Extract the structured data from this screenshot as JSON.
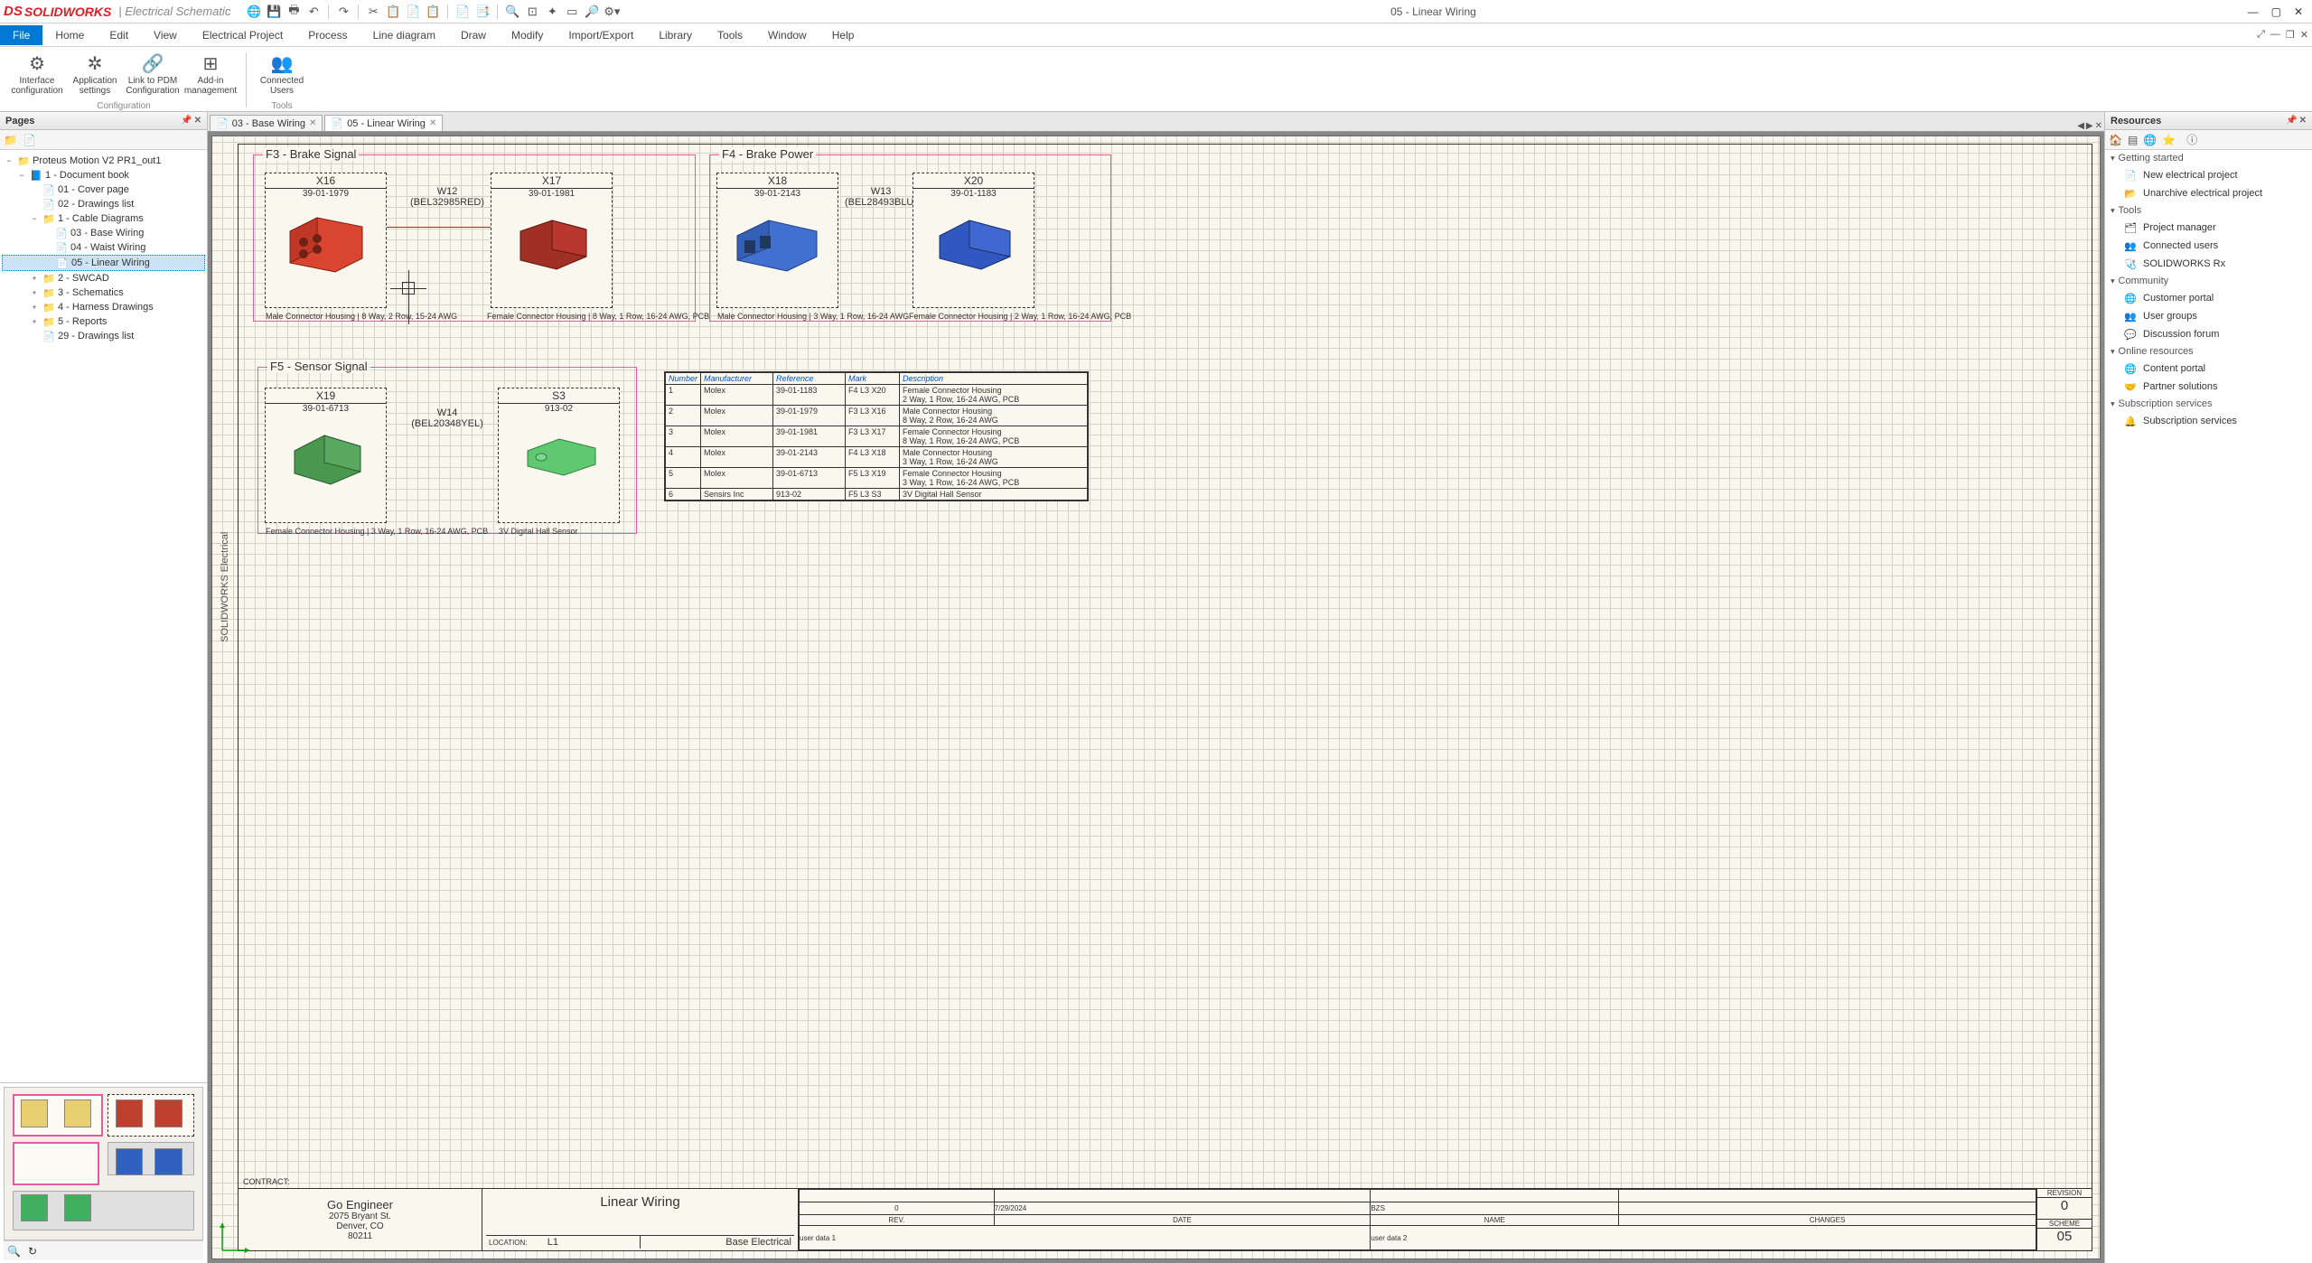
{
  "app": {
    "logo_ds": "DS",
    "logo": "SOLIDWORKS",
    "subtitle": "| Electrical Schematic",
    "window_title": "05 - Linear Wiring"
  },
  "menu": {
    "file": "File",
    "items": [
      "Home",
      "Edit",
      "View",
      "Electrical Project",
      "Process",
      "Line diagram",
      "Draw",
      "Modify",
      "Import/Export",
      "Library",
      "Tools",
      "Window",
      "Help"
    ]
  },
  "ribbon": {
    "group1": {
      "label": "Configuration",
      "buttons": [
        {
          "label": "Interface configuration",
          "icon": "⚙"
        },
        {
          "label": "Application settings",
          "icon": "✲"
        },
        {
          "label": "Link to PDM Configuration",
          "icon": "🔗"
        },
        {
          "label": "Add-in management",
          "icon": "⊞"
        }
      ]
    },
    "group2": {
      "label": "Tools",
      "buttons": [
        {
          "label": "Connected Users",
          "icon": "👥"
        }
      ]
    }
  },
  "pages_panel": {
    "title": "Pages"
  },
  "tree": [
    {
      "lvl": 0,
      "exp": "−",
      "icon": "📁",
      "label": "Proteus Motion V2 PR1_out1"
    },
    {
      "lvl": 1,
      "exp": "−",
      "icon": "📘",
      "label": "1 - Document book"
    },
    {
      "lvl": 2,
      "exp": "",
      "icon": "📄",
      "label": "01 - Cover page"
    },
    {
      "lvl": 2,
      "exp": "",
      "icon": "📄",
      "label": "02 - Drawings list"
    },
    {
      "lvl": 2,
      "exp": "−",
      "icon": "📁",
      "label": "1 - Cable Diagrams"
    },
    {
      "lvl": 3,
      "exp": "",
      "icon": "📄",
      "label": "03 - Base Wiring"
    },
    {
      "lvl": 3,
      "exp": "",
      "icon": "📄",
      "label": "04 - Waist Wiring"
    },
    {
      "lvl": 3,
      "exp": "",
      "icon": "📄",
      "label": "05 - Linear Wiring",
      "sel": true
    },
    {
      "lvl": 2,
      "exp": "+",
      "icon": "📁",
      "label": "2 - SWCAD"
    },
    {
      "lvl": 2,
      "exp": "+",
      "icon": "📁",
      "label": "3 - Schematics"
    },
    {
      "lvl": 2,
      "exp": "+",
      "icon": "📁",
      "label": "4 - Harness Drawings"
    },
    {
      "lvl": 2,
      "exp": "+",
      "icon": "📁",
      "label": "5 - Reports"
    },
    {
      "lvl": 2,
      "exp": "",
      "icon": "📄",
      "label": "29 - Drawings list"
    }
  ],
  "tabs": [
    {
      "icon": "📄",
      "label": "03 - Base Wiring",
      "active": false
    },
    {
      "icon": "📄",
      "label": "05 - Linear Wiring",
      "active": true
    }
  ],
  "drawing": {
    "vtext": "SOLIDWORKS Electrical",
    "f3": {
      "label": "F3 - Brake Signal"
    },
    "f4": {
      "label": "F4 - Brake Power"
    },
    "f5": {
      "label": "F5 - Sensor Signal"
    },
    "x16": {
      "name": "X16",
      "pn": "39-01-1979",
      "desc": "Male Connector Housing | 8 Way, 2 Row, 15-24 AWG"
    },
    "x17": {
      "name": "X17",
      "pn": "39-01-1981",
      "desc": "Female Connector Housing | 8 Way, 1 Row, 16-24 AWG, PCB"
    },
    "x18": {
      "name": "X18",
      "pn": "39-01-2143",
      "desc": "Male Connector Housing | 3 Way, 1 Row, 16-24 AWG"
    },
    "x20": {
      "name": "X20",
      "pn": "39-01-1183",
      "desc": "Female Connector Housing | 2 Way, 1 Row, 16-24 AWG, PCB"
    },
    "x19": {
      "name": "X19",
      "pn": "39-01-6713",
      "desc": "Female Connector Housing | 3 Way, 1 Row, 16-24 AWG, PCB"
    },
    "s3": {
      "name": "S3",
      "pn": "913-02",
      "desc": "3V Digital Hall Sensor"
    },
    "w12": {
      "name": "W12",
      "code": "(BEL32985RED)"
    },
    "w13": {
      "name": "W13",
      "code": "(BEL28493BLU)"
    },
    "w14": {
      "name": "W14",
      "code": "(BEL20348YEL)"
    }
  },
  "bom": {
    "headers": {
      "num": "Number",
      "mfr": "Manufacturer",
      "ref": "Reference",
      "mark": "Mark",
      "desc": "Description"
    },
    "rows": [
      {
        "n": "1",
        "mfr": "Molex",
        "ref": "39-01-1183",
        "mark": "F4 L3 X20",
        "desc": "Female Connector Housing\n2 Way, 1 Row, 16-24 AWG, PCB"
      },
      {
        "n": "2",
        "mfr": "Molex",
        "ref": "39-01-1979",
        "mark": "F3 L3 X16",
        "desc": "Male Connector Housing\n8 Way, 2 Row, 16-24 AWG"
      },
      {
        "n": "3",
        "mfr": "Molex",
        "ref": "39-01-1981",
        "mark": "F3 L3 X17",
        "desc": "Female Connector Housing\n8 Way, 1 Row, 16-24 AWG, PCB"
      },
      {
        "n": "4",
        "mfr": "Molex",
        "ref": "39-01-2143",
        "mark": "F4 L3 X18",
        "desc": "Male Connector Housing\n3 Way, 1 Row, 16-24 AWG"
      },
      {
        "n": "5",
        "mfr": "Molex",
        "ref": "39-01-6713",
        "mark": "F5 L3 X19",
        "desc": "Female Connector Housing\n3 Way, 1 Row, 16-24 AWG, PCB"
      },
      {
        "n": "6",
        "mfr": "Sensirs Inc",
        "ref": "913-02",
        "mark": "F5 L3 S3",
        "desc": "3V Digital Hall Sensor"
      }
    ]
  },
  "titleblock": {
    "company": "Go Engineer",
    "addr1": "2075 Bryant St.",
    "addr2": "Denver, CO",
    "addr3": "80211",
    "contract": "CONTRACT:",
    "location": "LOCATION:",
    "loc_val": "L1",
    "title": "Linear Wiring",
    "sub": "Base Electrical",
    "rev_hdr": "REV.",
    "date_hdr": "DATE",
    "name_hdr": "NAME",
    "changes_hdr": "CHANGES",
    "rev0": "0",
    "date0": "7/29/2024",
    "name0": "BZS",
    "ud1": "user data 1",
    "ud2": "user data 2",
    "revision": "REVISION",
    "rev_val": "0",
    "scheme": "SCHEME",
    "scheme_val": "05"
  },
  "resources": {
    "title": "Resources",
    "sections": [
      {
        "header": "Getting started",
        "items": [
          {
            "icon": "📄",
            "label": "New electrical project"
          },
          {
            "icon": "📂",
            "label": "Unarchive electrical project"
          }
        ]
      },
      {
        "header": "Tools",
        "items": [
          {
            "icon": "🗂",
            "label": "Project manager"
          },
          {
            "icon": "👥",
            "label": "Connected users"
          },
          {
            "icon": "🩺",
            "label": "SOLIDWORKS Rx"
          }
        ]
      },
      {
        "header": "Community",
        "items": [
          {
            "icon": "🌐",
            "label": "Customer portal"
          },
          {
            "icon": "👥",
            "label": "User groups"
          },
          {
            "icon": "💬",
            "label": "Discussion forum"
          }
        ]
      },
      {
        "header": "Online resources",
        "items": [
          {
            "icon": "🌐",
            "label": "Content portal"
          },
          {
            "icon": "🤝",
            "label": "Partner solutions"
          }
        ]
      },
      {
        "header": "Subscription services",
        "items": [
          {
            "icon": "🔔",
            "label": "Subscription services"
          }
        ]
      }
    ]
  }
}
